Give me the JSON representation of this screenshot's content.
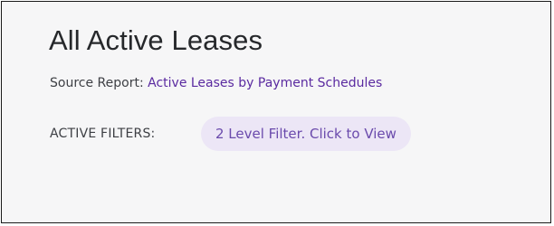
{
  "header": {
    "title": "All Active Leases"
  },
  "source": {
    "label": "Source Report: ",
    "link_text": "Active Leases by Payment Schedules"
  },
  "filters": {
    "label": "ACTIVE FILTERS:",
    "chip_text": "2 Level Filter. Click to View"
  },
  "colors": {
    "accent": "#5a2aa0",
    "chip_background": "#ece6f6",
    "chip_text": "#6a4aac",
    "panel_background": "#f6f6f7"
  }
}
